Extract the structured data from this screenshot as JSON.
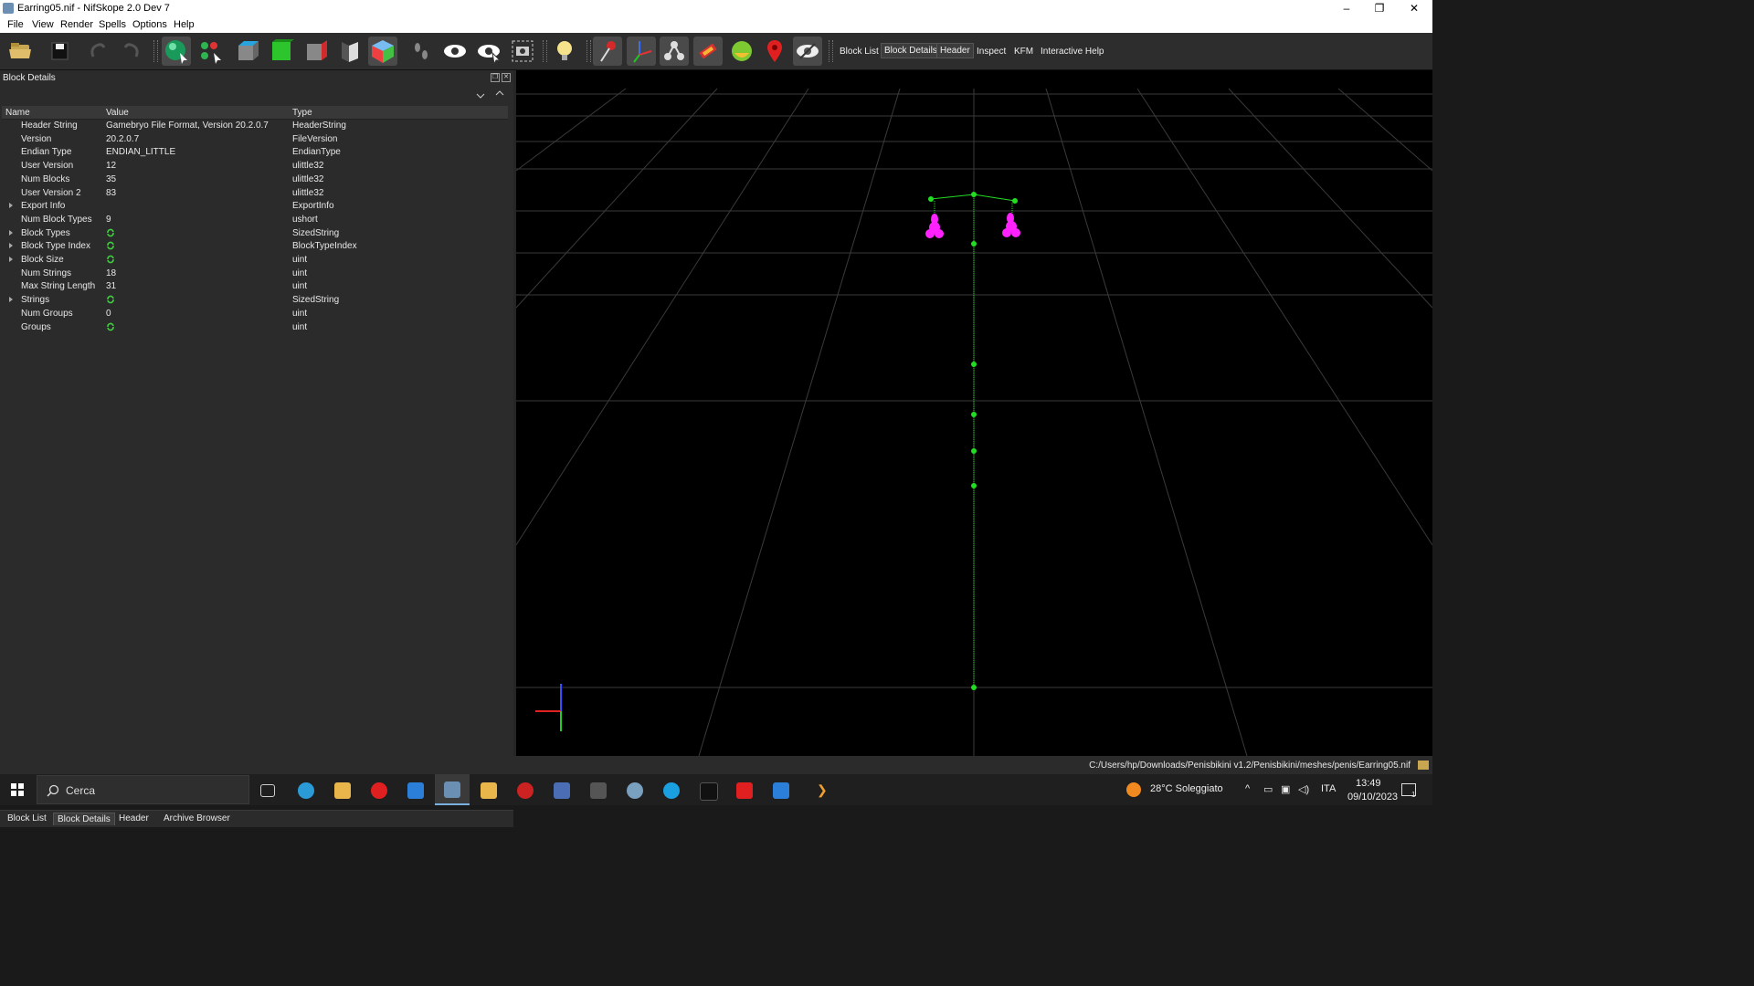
{
  "window": {
    "title": "Earring05.nif - NifSkope 2.0 Dev 7",
    "controls": [
      "–",
      "❐",
      "✕"
    ]
  },
  "menu": [
    "File",
    "View",
    "Render",
    "Spells",
    "Options",
    "Help"
  ],
  "toolbar": {
    "text_buttons": [
      {
        "label": "Block List",
        "active": false
      },
      {
        "label": "Block Details",
        "active": true
      },
      {
        "label": "Header",
        "active": true
      },
      {
        "label": "Inspect",
        "active": false
      },
      {
        "label": "KFM",
        "active": false
      },
      {
        "label": "Interactive Help",
        "active": false
      }
    ]
  },
  "panel": {
    "title": "Block Details",
    "columns": [
      "Name",
      "Value",
      "Type"
    ],
    "rows": [
      {
        "name": "Header String",
        "value": "Gamebryo File Format, Version 20.2.0.7",
        "type": "HeaderString",
        "expandable": false,
        "link": false
      },
      {
        "name": "Version",
        "value": "20.2.0.7",
        "type": "FileVersion",
        "expandable": false,
        "link": false
      },
      {
        "name": "Endian Type",
        "value": "ENDIAN_LITTLE",
        "type": "EndianType",
        "expandable": false,
        "link": false
      },
      {
        "name": "User Version",
        "value": "12",
        "type": "ulittle32",
        "expandable": false,
        "link": false
      },
      {
        "name": "Num Blocks",
        "value": "35",
        "type": "ulittle32",
        "expandable": false,
        "link": false
      },
      {
        "name": "User Version 2",
        "value": "83",
        "type": "ulittle32",
        "expandable": false,
        "link": false
      },
      {
        "name": "Export Info",
        "value": "",
        "type": "ExportInfo",
        "expandable": true,
        "link": false
      },
      {
        "name": "Num Block Types",
        "value": "9",
        "type": "ushort",
        "expandable": false,
        "link": false
      },
      {
        "name": "Block Types",
        "value": "",
        "type": "SizedString",
        "expandable": true,
        "link": true
      },
      {
        "name": "Block Type Index",
        "value": "",
        "type": "BlockTypeIndex",
        "expandable": true,
        "link": true
      },
      {
        "name": "Block Size",
        "value": "",
        "type": "uint",
        "expandable": true,
        "link": true
      },
      {
        "name": "Num Strings",
        "value": "18",
        "type": "uint",
        "expandable": false,
        "link": false
      },
      {
        "name": "Max String Length",
        "value": "31",
        "type": "uint",
        "expandable": false,
        "link": false
      },
      {
        "name": "Strings",
        "value": "",
        "type": "SizedString",
        "expandable": true,
        "link": true
      },
      {
        "name": "Num Groups",
        "value": "0",
        "type": "uint",
        "expandable": false,
        "link": false
      },
      {
        "name": "Groups",
        "value": "",
        "type": "uint",
        "expandable": false,
        "link": true
      }
    ],
    "bottom_tabs": [
      {
        "label": "Block List",
        "active": false
      },
      {
        "label": "Block Details",
        "active": true
      },
      {
        "label": "Header",
        "active": false
      },
      {
        "label": "Archive Browser",
        "active": false
      }
    ]
  },
  "viewport": {
    "background": "#000000",
    "grid_color": "#3a3a3a",
    "skeleton_color": "#22dd22",
    "mesh_color": "#ff22ff"
  },
  "status": {
    "path": "C:/Users/hp/Downloads/Penisbikini v1.2/Penisbikini/meshes/penis/Earring05.nif"
  },
  "taskbar": {
    "search_placeholder": "Cerca",
    "weather": "28°C  Soleggiato",
    "language": "ITA",
    "time": "13:49",
    "date": "09/10/2023",
    "notification_count": "1"
  }
}
